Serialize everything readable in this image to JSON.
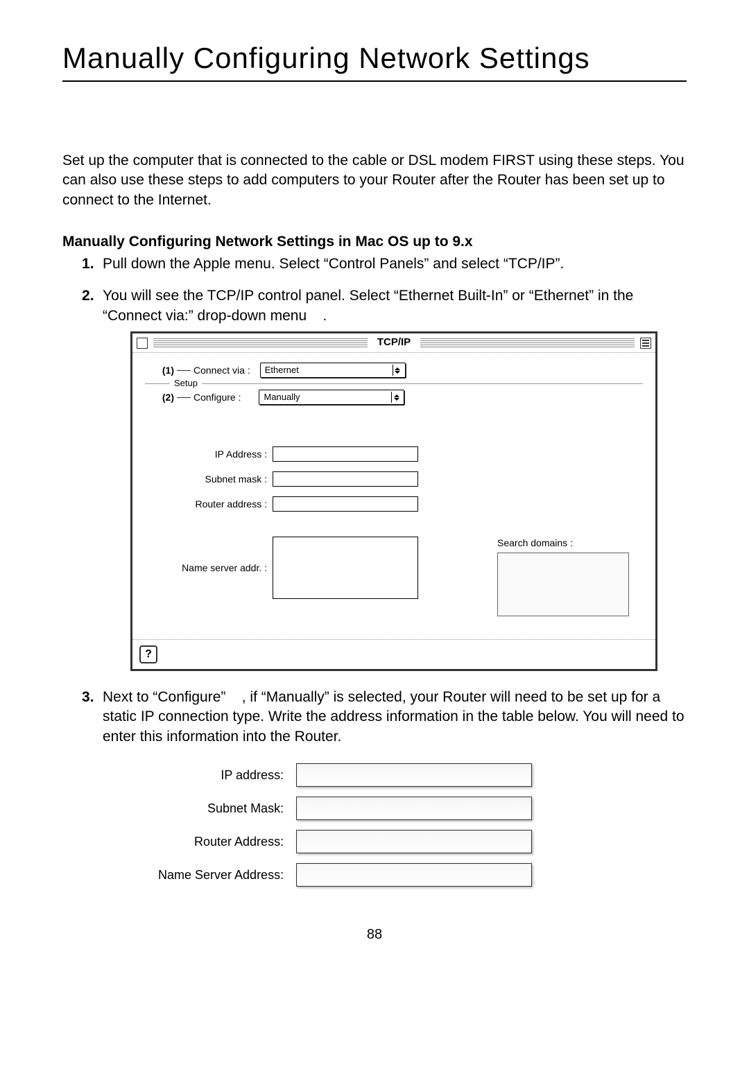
{
  "title": "Manually Configuring Network Settings",
  "intro": "Set up the computer that is connected to the cable or DSL modem FIRST using these steps. You can also use these steps to add computers to your Router after the Router has been set up to connect to the Internet.",
  "subhead": "Manually Configuring Network Settings in Mac OS up to 9.x",
  "steps": {
    "s1": "Pull down the Apple menu. Select “Control Panels” and select “TCP/IP”.",
    "s2": "You will see the TCP/IP control panel. Select “Ethernet Built-In” or “Ethernet” in the “Connect via:” drop-down menu    .",
    "s3": "Next to “Configure”    , if “Manually” is selected, your Router will need to be set up for a static IP connection type. Write the address information in the table below. You will need to enter this information into the Router."
  },
  "dialog": {
    "title": "TCP/IP",
    "callout1": "(1)",
    "callout2": "(2)",
    "connect_via_label": "Connect via :",
    "connect_via_value": "Ethernet",
    "setup_label": "Setup",
    "configure_label": "Configure :",
    "configure_value": "Manually",
    "ip_label": "IP Address :",
    "subnet_label": "Subnet mask :",
    "router_label": "Router address :",
    "ns_label": "Name server addr. :",
    "search_domains_label": "Search domains :",
    "help_glyph": "?"
  },
  "form": {
    "ip": "IP address:",
    "subnet": "Subnet Mask:",
    "router": "Router Address:",
    "ns": "Name Server Address:"
  },
  "page_number": "88"
}
